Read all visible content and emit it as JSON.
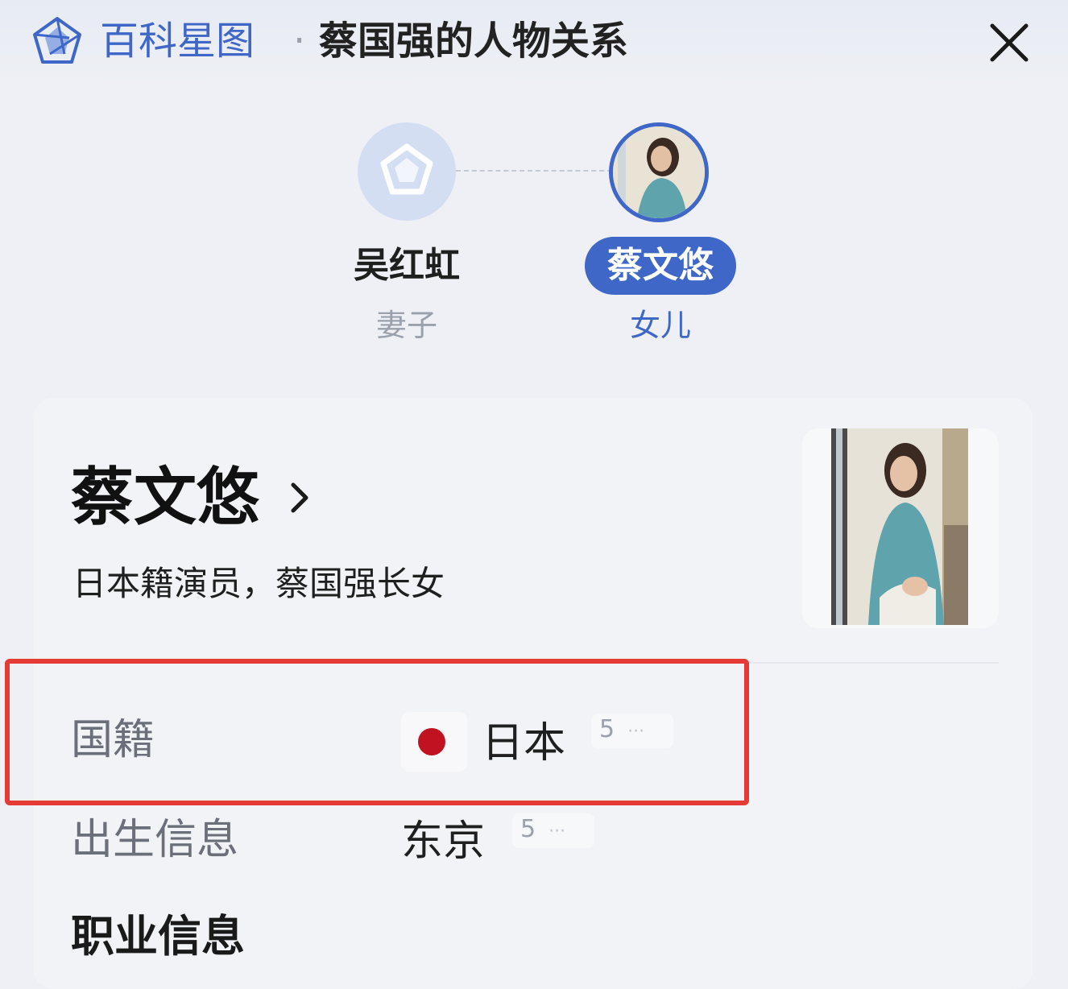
{
  "header": {
    "brand": "百科星图",
    "separator": "·",
    "title": "蔡国强的人物关系",
    "logo_icon": "star-logo-icon",
    "close_icon": "close-icon",
    "brand_color": "#3f67c8"
  },
  "relations": [
    {
      "name": "吴红虹",
      "relation": "妻子",
      "avatar": "star-placeholder-icon",
      "selected": false
    },
    {
      "name": "蔡文悠",
      "relation": "女儿",
      "avatar": "portrait-photo",
      "selected": true
    }
  ],
  "profile": {
    "name": "蔡文悠",
    "chevron_icon": "chevron-right-icon",
    "description": "日本籍演员，蔡国强长女",
    "facts": [
      {
        "label": "国籍",
        "value": "日本",
        "count": "5",
        "more": "···",
        "flag_color": "#c1121f",
        "highlighted": true
      },
      {
        "label": "出生信息",
        "value": "东京",
        "count": "5",
        "more": "···",
        "highlighted": false
      }
    ],
    "section_heading": "职业信息"
  },
  "colors": {
    "accent": "#3f67c8",
    "highlight_border": "#e53a35"
  }
}
